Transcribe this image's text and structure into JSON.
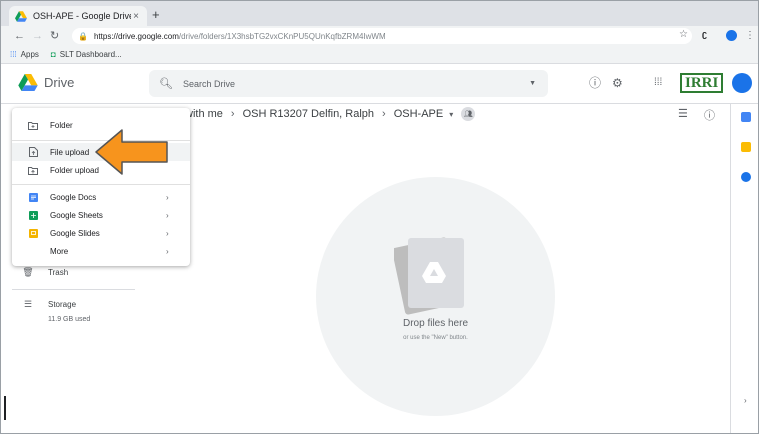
{
  "browser": {
    "tab_title": "OSH-APE - Google Drive",
    "tab_close": "×",
    "new_tab": "+",
    "url_host": "https://drive.google.com",
    "url_path": "/drive/folders/1X3hsbTG2vxCKnPU5QUnKqfbZRM4IwWM",
    "bookmarks": [
      {
        "icon": "apps-grid-icon",
        "label": "Apps"
      },
      {
        "icon": "slt-icon",
        "label": "SLT Dashboard..."
      }
    ]
  },
  "drive": {
    "app_name": "Drive",
    "search_placeholder": "Search Drive",
    "brand_logo": "IRRI",
    "brand_color": "#2e7d32",
    "accent": "#1a73e8"
  },
  "breadcrumb": [
    {
      "label": "with me"
    },
    {
      "label": "OSH R13207 Delfin, Ralph"
    },
    {
      "label": "OSH-APE"
    }
  ],
  "new_menu": {
    "items": [
      {
        "label": "Folder",
        "icon": "new-folder-icon"
      },
      {
        "label": "File upload",
        "icon": "file-upload-icon",
        "highlighted": true
      },
      {
        "label": "Folder upload",
        "icon": "folder-upload-icon"
      },
      {
        "label": "Google Docs",
        "icon": "google-docs-icon",
        "color": "#4285f4",
        "submenu": true
      },
      {
        "label": "Google Sheets",
        "icon": "google-sheets-icon",
        "color": "#0f9d58",
        "submenu": true
      },
      {
        "label": "Google Slides",
        "icon": "google-slides-icon",
        "color": "#f4b400",
        "submenu": true
      },
      {
        "label": "More",
        "icon": "",
        "submenu": true
      }
    ]
  },
  "left_nav": {
    "trash": "Trash",
    "storage": "Storage",
    "storage_used": "11.9 GB used"
  },
  "empty_state": {
    "title": "Drop files here",
    "subtitle": "or use the \"New\" button."
  },
  "annotation": {
    "arrow_color": "#f7941d",
    "arrow_outline": "#555555"
  }
}
